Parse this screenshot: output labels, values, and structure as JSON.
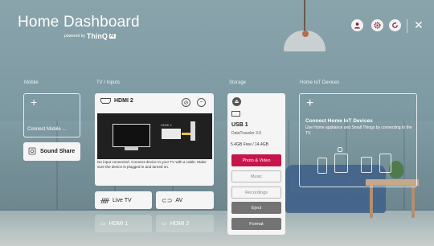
{
  "header": {
    "title": "Home Dashboard",
    "powered_by": "powered by",
    "brand": "ThinQ",
    "ai_badge": "AI"
  },
  "top_icons": [
    "account-icon",
    "settings-icon",
    "refresh-icon"
  ],
  "close_label": "✕",
  "sections": {
    "mobile": "Mobile",
    "tv_inputs": "TV / Inputs",
    "storage": "Storage",
    "home_iot": "Home IoT Devices"
  },
  "mobile": {
    "connect_label": "Connect Mobile ...",
    "sound_share_label": "Sound Share"
  },
  "tv_inputs": {
    "selected": {
      "name": "HDMI 2",
      "illustration_label": "HDMI 2",
      "message": "No input connected. Connect device to your TV with a cable. Make sure the device is plugged in and turned on."
    },
    "cards": [
      {
        "label": "Live TV"
      },
      {
        "label": "AV"
      },
      {
        "label": "HDMI 1"
      },
      {
        "label": "HDMI 2"
      }
    ]
  },
  "storage": {
    "device_name": "USB 1",
    "model": "DataTraveler 3.0",
    "free_space": "5.4GB Free / 14.4GB",
    "buttons": [
      {
        "label": "Photo & Video",
        "state": "active"
      },
      {
        "label": "Music",
        "state": "plain"
      },
      {
        "label": "Recordings",
        "state": "plain"
      },
      {
        "label": "Eject",
        "state": "dark"
      },
      {
        "label": "Format",
        "state": "dark"
      }
    ]
  },
  "iot": {
    "title": "Connect Home IoT Devices",
    "description": "Use Home appliance and Small Things by connecting to the TV."
  },
  "colors": {
    "accent": "#c5154a",
    "card": "#f5f5f5"
  }
}
